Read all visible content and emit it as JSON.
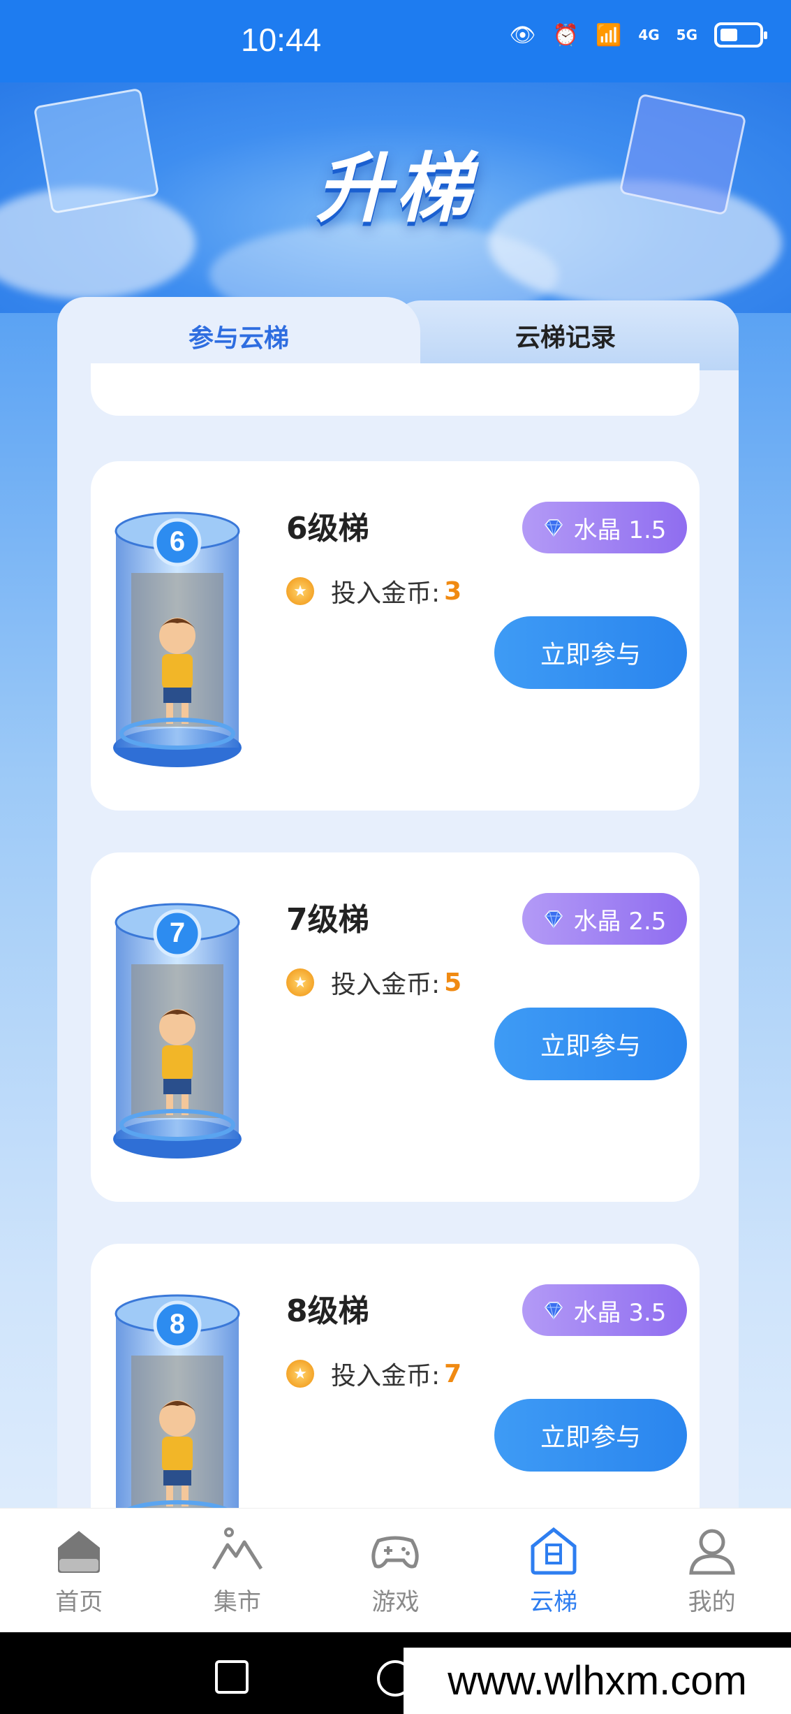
{
  "status": {
    "time": "10:44",
    "net1": "4G",
    "net2": "5G"
  },
  "hero": {
    "title": "升梯"
  },
  "tabs": [
    {
      "label": "参与云梯",
      "active": true
    },
    {
      "label": "云梯记录",
      "active": false
    }
  ],
  "cards": [
    {
      "badge": "6",
      "level": "6级梯",
      "crystal_label": "水晶 1.5",
      "coins_label": "投入金币:",
      "coins_value": "3",
      "button": "立即参与"
    },
    {
      "badge": "7",
      "level": "7级梯",
      "crystal_label": "水晶 2.5",
      "coins_label": "投入金币:",
      "coins_value": "5",
      "button": "立即参与"
    },
    {
      "badge": "8",
      "level": "8级梯",
      "crystal_label": "水晶 3.5",
      "coins_label": "投入金币:",
      "coins_value": "7",
      "button": "立即参与"
    }
  ],
  "nav": [
    {
      "label": "首页",
      "icon": "home-icon"
    },
    {
      "label": "集市",
      "icon": "mountain-icon"
    },
    {
      "label": "游戏",
      "icon": "gamepad-icon"
    },
    {
      "label": "云梯",
      "icon": "ladder-icon",
      "active": true
    },
    {
      "label": "我的",
      "icon": "user-icon"
    }
  ],
  "colors": {
    "primary": "#2e7ef0",
    "crystal": "#9a7cf2",
    "coin": "#f08a12"
  },
  "watermark": "www.wlhxm.com"
}
